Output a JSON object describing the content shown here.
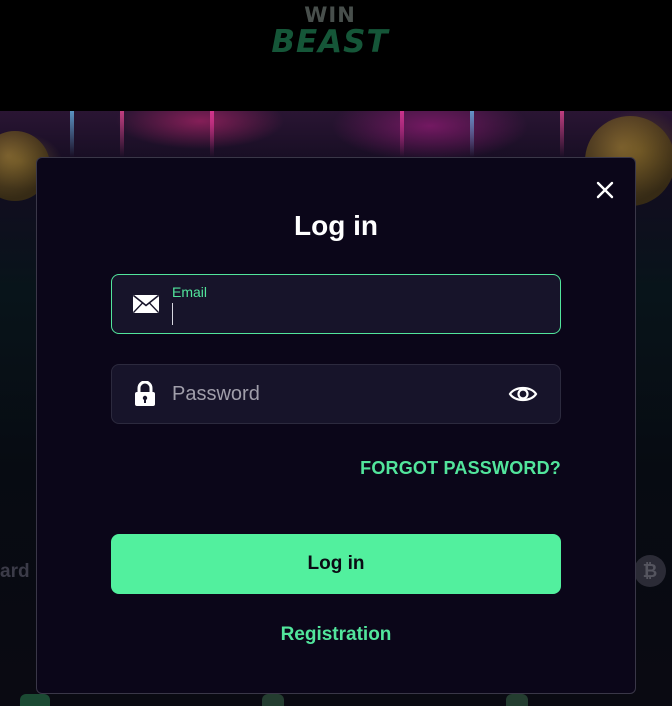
{
  "header": {
    "logo_line1": "WIN",
    "logo_line2": "BEAST"
  },
  "background": {
    "side_text_left": "ard",
    "crypto_symbol": "₿"
  },
  "modal": {
    "title": "Log in",
    "email": {
      "label": "Email",
      "value": "",
      "icon": "envelope-icon"
    },
    "password": {
      "placeholder": "Password",
      "value": "",
      "icon": "lock-icon",
      "toggle_icon": "eye-icon"
    },
    "forgot_password": "FORGOT PASSWORD?",
    "submit_label": "Log in",
    "register_link": "Registration",
    "close_icon": "close-icon"
  },
  "colors": {
    "accent": "#52f09e",
    "modal_bg": "#0b0619",
    "field_bg": "#17142a",
    "page_bg": "#000000"
  }
}
